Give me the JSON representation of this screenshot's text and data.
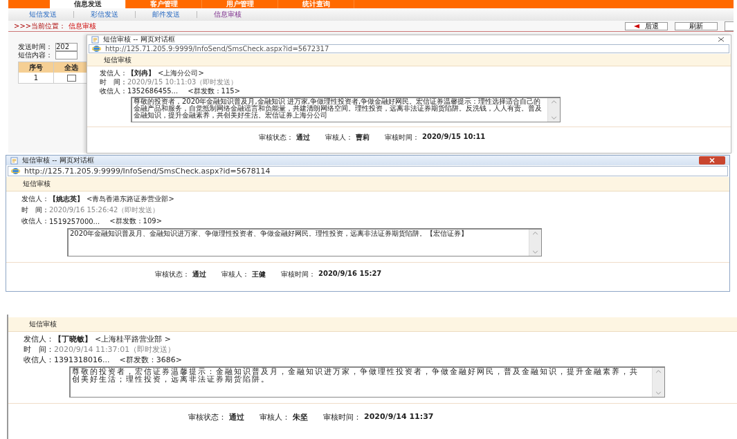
{
  "app": {
    "nav_tabs": [
      {
        "label": "信息发送",
        "selected": true
      },
      {
        "label": "客户管理",
        "selected": false
      },
      {
        "label": "用户管理",
        "selected": false
      },
      {
        "label": "统计查询",
        "selected": false
      }
    ],
    "sub_nav": [
      {
        "label": "短信发送",
        "selected": false
      },
      {
        "label": "彩信发送",
        "selected": false
      },
      {
        "label": "邮件发送",
        "selected": false
      },
      {
        "label": "信息审核",
        "selected": true
      }
    ],
    "breadcrumb": {
      "label": ">>>当前位置：",
      "current": "信息审核"
    },
    "buttons": [
      "后退",
      "刷新"
    ],
    "form": {
      "send_time_label": "发送时间：",
      "send_time_value": "202",
      "content_label": "短信内容："
    },
    "table": {
      "columns": [
        "序号",
        "全选"
      ],
      "rows": [
        {
          "index": "1",
          "checked": false
        }
      ]
    }
  },
  "dialogs": [
    {
      "kind": "overlay",
      "title": "短信审核 -- 网页对话框",
      "url": "http://125.71.205.9:9999/InfoSend/SmsCheck.aspx?id=5672317",
      "header": "短信审核",
      "sender_label": "发信人：",
      "sender_name": "【刘冉】",
      "sender_branch": "<上海分公司>",
      "time_label": "时　间：",
      "time_value": "2020/9/15 10:11:03（即时发送）",
      "recipient_label": "收信人：",
      "recipient_value": "1352686455...",
      "recipient_count": "<群发数：115>",
      "message": "尊敬的投资者，2020年金融知识普及月,金融知识 进万家,争做理性投资者,争做金融好网民。宏信证券温馨提示：理性选择适合自己的金融产品和服务，自觉抵制网络金融谣言和负能量，共建清朗网络空间。理性投资，远离非法证券期货陷阱。反洗钱，人人有责。普及金融知识，提升金融素养，共创美好生活。宏信证券上海分公司",
      "status_label": "审核状态：",
      "status_value": "通过",
      "reviewer_label": "审核人：",
      "reviewer_value": "曹莉",
      "review_time_label": "审核时间：",
      "review_time_value": "2020/9/15 10:11"
    },
    {
      "kind": "window",
      "title": "短信审核 -- 网页对话框",
      "url": "http://125.71.205.9:9999/InfoSend/SmsCheck.aspx?id=5678114",
      "header": "短信审核",
      "sender_label": "发信人：",
      "sender_name": "【姚志英】",
      "sender_branch": "<青岛香港东路证券营业部>",
      "time_label": "时　间：",
      "time_value": "2020/9/16 15:26:42（即时发送）",
      "recipient_label": "收信人：",
      "recipient_value": "1519257000...",
      "recipient_count": "<群发数：109>",
      "message": "2020年金融知识普及月、金融知识进万家、争做理性投资者、争做金融好网民。理性投资，远离非法证券期货陷阱。【宏信证券】",
      "status_label": "审核状态：",
      "status_value": "通过",
      "reviewer_label": "审核人：",
      "reviewer_value": "王健",
      "review_time_label": "审核时间：",
      "review_time_value": "2020/9/16 15:27"
    },
    {
      "kind": "crop",
      "header": "短信审核",
      "sender_label": "发信人：",
      "sender_name": "【丁晓敏】",
      "sender_branch": "<上海桂平路营业部 >",
      "time_label": "时　间：",
      "time_value": "2020/9/14 11:37:01（即时发送）",
      "recipient_label": "收信人：",
      "recipient_value": "1391318016...",
      "recipient_count": "<群发数：3686>",
      "message": "尊敬的投资者，宏信证券温馨提示：金融知识普及月，金融知识进万家，争做理性投资者，争做金融好网民，普及金融知识，提升金融素养，共创美好生活；理性投资，远离非法证券期货陷阱。",
      "status_label": "审核状态：",
      "status_value": "通过",
      "reviewer_label": "审核人：",
      "reviewer_value": "朱坚",
      "review_time_label": "审核时间：",
      "review_time_value": "2020/9/14 11:37"
    }
  ]
}
